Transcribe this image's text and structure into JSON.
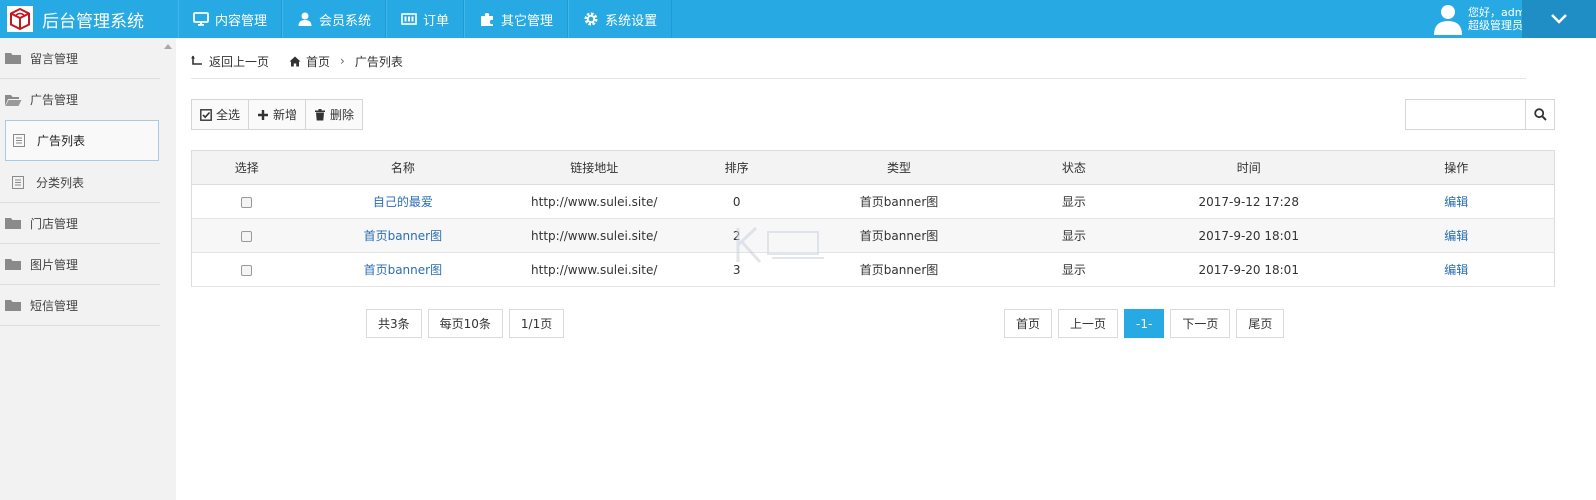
{
  "brand": {
    "title": "后台管理系统"
  },
  "nav": [
    {
      "label": "内容管理",
      "icon": "monitor-icon"
    },
    {
      "label": "会员系统",
      "icon": "user-icon"
    },
    {
      "label": "订单",
      "icon": "list-icon"
    },
    {
      "label": "其它管理",
      "icon": "puzzle-icon"
    },
    {
      "label": "系统设置",
      "icon": "gear-icon"
    }
  ],
  "user": {
    "greeting": "您好，admin",
    "role": "超级管理员"
  },
  "sidebar": {
    "groups": [
      {
        "label": "留言管理",
        "open": false
      },
      {
        "label": "广告管理",
        "open": true
      },
      {
        "label": "门店管理",
        "open": false
      },
      {
        "label": "图片管理",
        "open": false
      },
      {
        "label": "短信管理",
        "open": false
      }
    ],
    "subitems": [
      {
        "label": "广告列表",
        "active": true
      },
      {
        "label": "分类列表",
        "active": false
      }
    ]
  },
  "breadcrumb": {
    "back": "返回上一页",
    "home": "首页",
    "current": "广告列表"
  },
  "toolbar": {
    "select_all": "全选",
    "add": "新增",
    "delete": "删除"
  },
  "search": {
    "value": "",
    "placeholder": ""
  },
  "table": {
    "headers": [
      "选择",
      "名称",
      "链接地址",
      "排序",
      "类型",
      "状态",
      "时间",
      "操作"
    ],
    "rows": [
      {
        "name": "自己的最爱",
        "url": "http://www.sulei.site/",
        "sort": "0",
        "type": "首页banner图",
        "status": "显示",
        "time": "2017-9-12 17:28",
        "action": "编辑"
      },
      {
        "name": "首页banner图",
        "url": "http://www.sulei.site/",
        "sort": "2",
        "type": "首页banner图",
        "status": "显示",
        "time": "2017-9-20 18:01",
        "action": "编辑"
      },
      {
        "name": "首页banner图",
        "url": "http://www.sulei.site/",
        "sort": "3",
        "type": "首页banner图",
        "status": "显示",
        "time": "2017-9-20 18:01",
        "action": "编辑"
      }
    ]
  },
  "pagination": {
    "total": "共3条",
    "per_page": "每页10条",
    "page_of": "1/1页",
    "first": "首页",
    "prev": "上一页",
    "current": "-1-",
    "next": "下一页",
    "last": "尾页"
  },
  "colors": {
    "accent": "#27a9e3",
    "link": "#2a6eb5"
  }
}
